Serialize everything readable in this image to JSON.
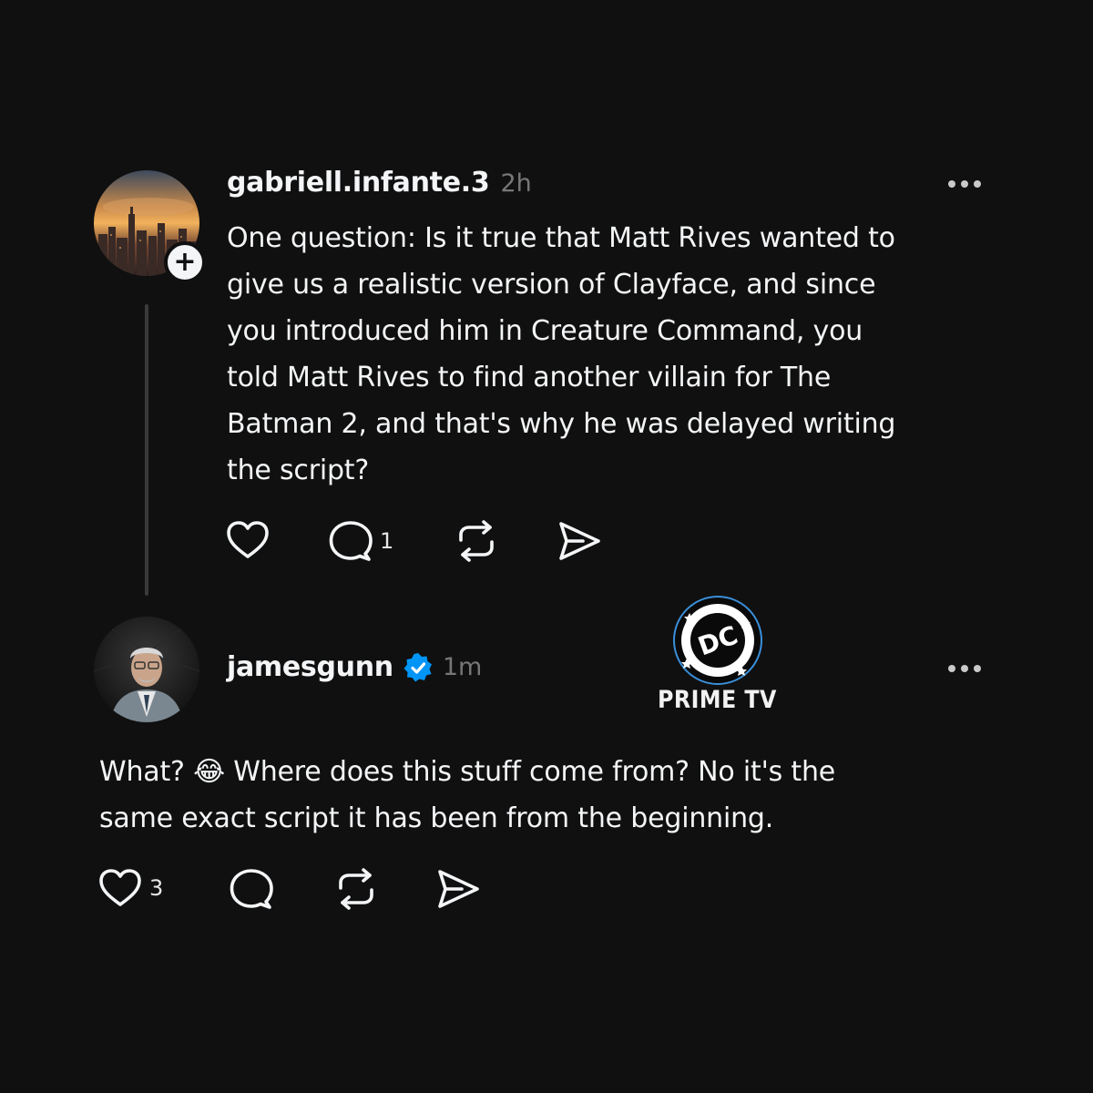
{
  "post": {
    "username": "gabriell.infante.3",
    "time": "2h",
    "text": "One question: Is it true that Matt Rives wanted to give us a realistic version of Clayface, and since you introduced him in Creature Command, you told Matt Rives to find another villain for The Batman 2, and that's why he was delayed writing the script?",
    "lines": [
      "One question: Is it true that Matt Rives wanted to",
      "give us a realistic version of Clayface, and since",
      "you introduced him in Creature Command, you",
      "told Matt Rives to find another villain for The",
      "Batman 2, and that's why he was delayed writing",
      "the script?"
    ],
    "follow_badge": "+",
    "actions": {
      "like_count": "",
      "reply_count": "1",
      "repost_count": "",
      "share_count": ""
    }
  },
  "reply": {
    "username": "jamesgunn",
    "verified": true,
    "time": "1m",
    "lines": [
      "What? 😂 Where does this stuff come from? No it's the",
      "same exact script it has been from the beginning."
    ],
    "actions": {
      "like_count": "3",
      "reply_count": "",
      "repost_count": "",
      "share_count": ""
    }
  },
  "watermark": {
    "logo_text": "DC",
    "label": "PRIME TV"
  },
  "icons": {
    "like": "heart-icon",
    "reply": "comment-icon",
    "repost": "repost-icon",
    "share": "send-icon",
    "more": "more-dots-icon",
    "verified": "verified-badge-icon"
  },
  "colors": {
    "background": "#101010",
    "text": "#f3f5f7",
    "secondary": "#777777",
    "verified": "#0095f6"
  }
}
